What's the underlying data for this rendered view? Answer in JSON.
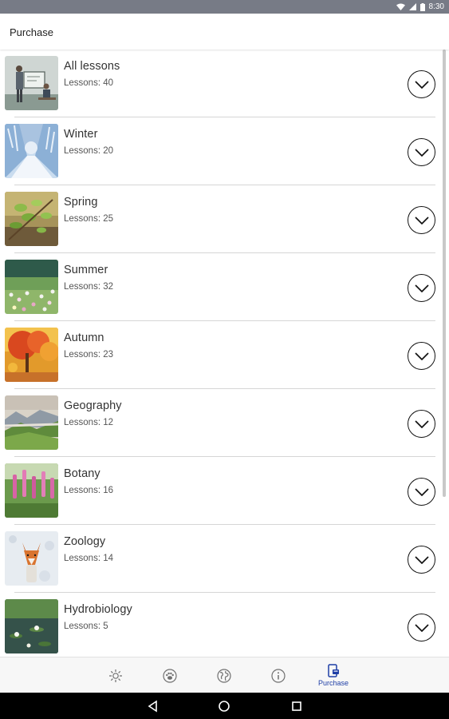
{
  "status_bar": {
    "time": "8:30"
  },
  "app_bar": {
    "title": "Purchase"
  },
  "lessons": [
    {
      "title": "All lessons",
      "subtitle": "Lessons: 40",
      "image": "classroom-photo"
    },
    {
      "title": "Winter",
      "subtitle": "Lessons: 20",
      "image": "snowy-forest-road-photo"
    },
    {
      "title": "Spring",
      "subtitle": "Lessons: 25",
      "image": "spring-leaves-photo"
    },
    {
      "title": "Summer",
      "subtitle": "Lessons: 32",
      "image": "summer-meadow-flowers-photo"
    },
    {
      "title": "Autumn",
      "subtitle": "Lessons: 23",
      "image": "autumn-tree-photo"
    },
    {
      "title": "Geography",
      "subtitle": "Lessons: 12",
      "image": "mountain-landscape-photo"
    },
    {
      "title": "Botany",
      "subtitle": "Lessons: 16",
      "image": "pink-flowers-photo"
    },
    {
      "title": "Zoology",
      "subtitle": "Lessons: 14",
      "image": "fox-photo"
    },
    {
      "title": "Hydrobiology",
      "subtitle": "Lessons: 5",
      "image": "pond-lilies-photo"
    }
  ],
  "bottom_nav": {
    "items": [
      {
        "icon": "sun-icon",
        "label": ""
      },
      {
        "icon": "paw-icon",
        "label": ""
      },
      {
        "icon": "globe-icon",
        "label": ""
      },
      {
        "icon": "info-icon",
        "label": ""
      },
      {
        "icon": "purchase-icon",
        "label": "Purchase"
      }
    ],
    "active_index": 4,
    "active_color": "#1f3fa6",
    "inactive_color": "#6f6f6f"
  },
  "colors": {
    "status_bar": "#777b86",
    "background": "#ffffff",
    "divider": "#d6d6d6"
  }
}
